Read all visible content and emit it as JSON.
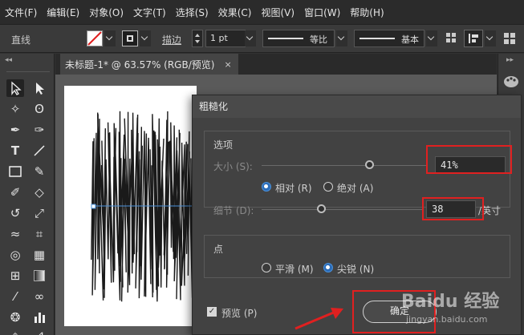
{
  "menu": [
    "文件(F)",
    "编辑(E)",
    "对象(O)",
    "文字(T)",
    "选择(S)",
    "效果(C)",
    "视图(V)",
    "窗口(W)",
    "帮助(H)"
  ],
  "control_bar": {
    "tool_name": "直线",
    "stroke_label": "描边",
    "stroke_value": "1 pt",
    "profile_label": "等比",
    "brush_label": "基本"
  },
  "document_tab": {
    "title": "未标题-1* @ 63.57% (RGB/预览)",
    "close": "×"
  },
  "dialog": {
    "title": "粗糙化",
    "options_legend": "选项",
    "size_label": "大小 (S):",
    "size_value": "41%",
    "size_slider_fraction": 0.41,
    "relative_label": "相对 (R)",
    "absolute_label": "绝对 (A)",
    "detail_label": "细节 (D):",
    "detail_value": "38",
    "detail_unit": "/英寸",
    "points_legend": "点",
    "smooth_label": "平滑 (M)",
    "corner_label": "尖锐 (N)",
    "preview_label": "预览 (P)",
    "ok_label": "确定"
  },
  "watermark": {
    "brand": "Baidu 经验",
    "url": "jingyan.baidu.com"
  },
  "colors": {
    "highlight": "#e02020",
    "arrow": "#e02020",
    "selection": "#4a90d9"
  }
}
